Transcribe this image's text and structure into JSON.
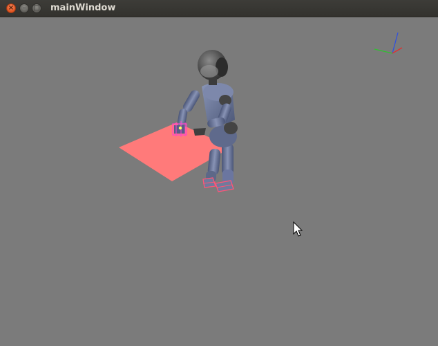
{
  "window": {
    "title": "mainWindow",
    "close_glyph": "×",
    "minimize_glyph": "–",
    "maximize_glyph": "□"
  },
  "viewport": {
    "background_color": "#7b7b7b",
    "scene": {
      "objects": [
        "humanoid-robot",
        "table-plane",
        "grasp-target",
        "axis-gizmo"
      ],
      "table_color": "#ff7878",
      "robot_color": "#6c7898",
      "head_color": "#5a5a5a"
    },
    "axis_colors": {
      "x": "#e03030",
      "y": "#30c030",
      "z": "#3050e0"
    }
  },
  "cursor": {
    "icon": "arrow-cursor-icon"
  }
}
